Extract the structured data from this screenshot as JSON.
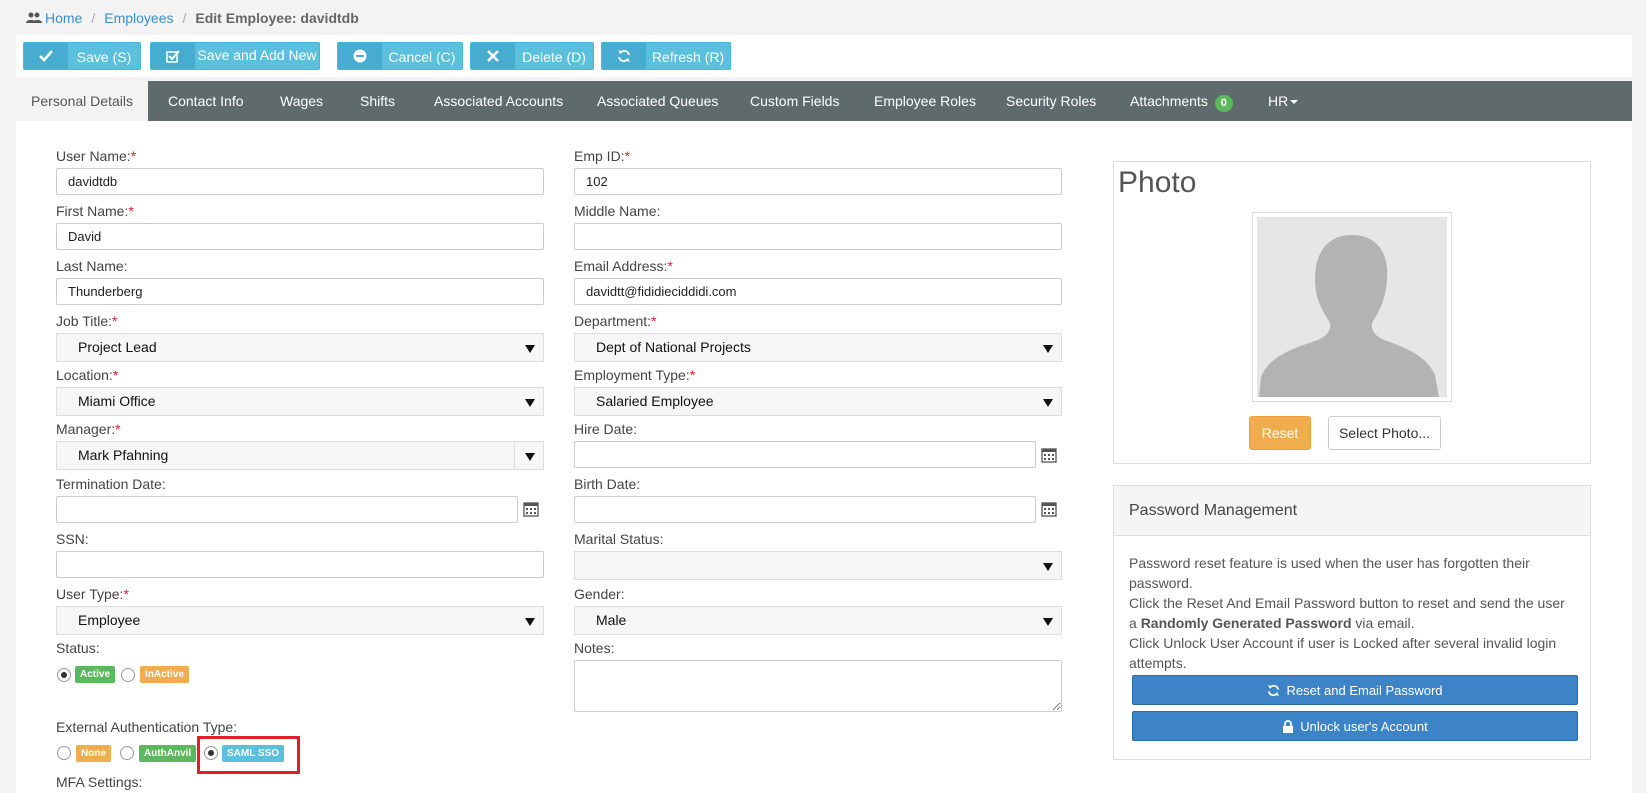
{
  "breadcrumb": {
    "home": "Home",
    "employees": "Employees",
    "current": "Edit Employee: davidtdb"
  },
  "toolbar": {
    "save": "Save (S)",
    "save_add": "Save and Add New",
    "cancel": "Cancel (C)",
    "delete": "Delete (D)",
    "refresh": "Refresh (R)"
  },
  "tabs": {
    "personal": "Personal Details",
    "contact": "Contact Info",
    "wages": "Wages",
    "shifts": "Shifts",
    "accounts": "Associated Accounts",
    "queues": "Associated Queues",
    "custom": "Custom Fields",
    "emp_roles": "Employee Roles",
    "sec_roles": "Security Roles",
    "attachments": "Attachments",
    "attachments_count": "0",
    "hr": "HR"
  },
  "form": {
    "username_label": "User Name:",
    "username": "davidtdb",
    "empid_label": "Emp ID:",
    "empid": "102",
    "first_label": "First Name:",
    "first": "David",
    "middle_label": "Middle Name:",
    "middle": "",
    "last_label": "Last Name:",
    "last": "Thunderberg",
    "email_label": "Email Address:",
    "email": "davidtt@fididieciddidi.com",
    "jobtitle_label": "Job Title:",
    "jobtitle": "Project Lead",
    "department_label": "Department:",
    "department": "Dept of National Projects",
    "location_label": "Location:",
    "location": "Miami Office",
    "emptype_label": "Employment Type:",
    "emptype": "Salaried Employee",
    "manager_label": "Manager:",
    "manager": "Mark Pfahning",
    "hire_label": "Hire Date:",
    "hire": "",
    "term_label": "Termination Date:",
    "term": "",
    "birth_label": "Birth Date:",
    "birth": "",
    "ssn_label": "SSN:",
    "ssn": "",
    "marital_label": "Marital Status:",
    "marital": "",
    "usertype_label": "User Type:",
    "usertype": "Employee",
    "gender_label": "Gender:",
    "gender": "Male",
    "status_label": "Status:",
    "status_active": "Active",
    "status_inactive": "InActive",
    "notes_label": "Notes:",
    "extauth_label": "External Authentication Type:",
    "extauth_none": "None",
    "extauth_authanvil": "AuthAnvil",
    "extauth_saml": "SAML SSO",
    "mfa_label": "MFA Settings:",
    "required_mark": "*"
  },
  "photo": {
    "title": "Photo",
    "reset": "Reset",
    "select": "Select Photo..."
  },
  "password": {
    "title": "Password Management",
    "text1": "Password reset feature is used when the user has forgotten their password.",
    "text2a": "Click the Reset And Email Password button to reset and send the user a ",
    "text2b": "Randomly Generated Password",
    "text2c": " via email.",
    "text3": "Click Unlock User Account if user is Locked after several invalid login attempts.",
    "btn_reset": "Reset and Email Password",
    "btn_unlock": "Unlock user's Account"
  },
  "colors": {
    "tabbar": "#5f6a6c",
    "toolbar_button": "#5bc0de",
    "primary": "#3c84c7",
    "highlight": "#e01f26"
  }
}
